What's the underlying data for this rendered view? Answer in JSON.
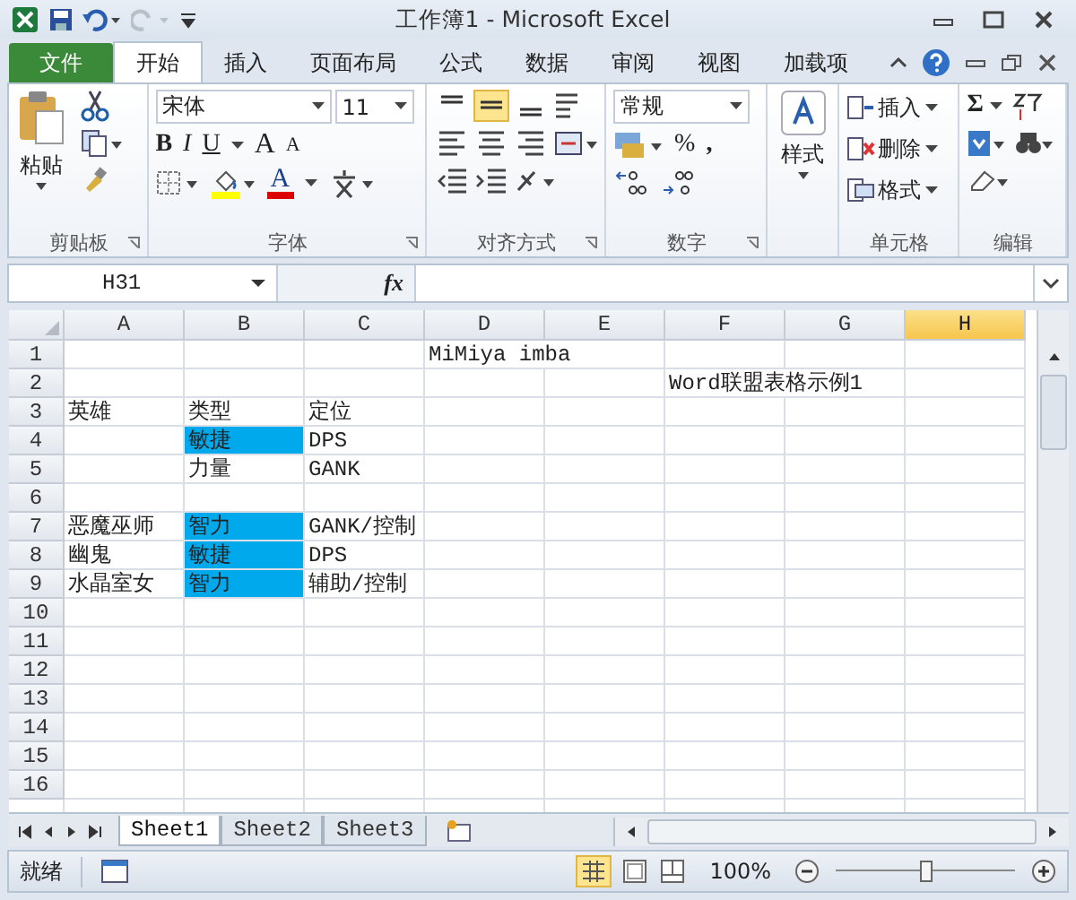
{
  "window": {
    "title": "工作簿1 - Microsoft Excel"
  },
  "ribbon_tabs": [
    {
      "label": "文件",
      "kind": "file",
      "selected": false
    },
    {
      "label": "开始",
      "kind": "tab",
      "selected": true
    },
    {
      "label": "插入",
      "kind": "tab",
      "selected": false
    },
    {
      "label": "页面布局",
      "kind": "tab",
      "selected": false
    },
    {
      "label": "公式",
      "kind": "tab",
      "selected": false
    },
    {
      "label": "数据",
      "kind": "tab",
      "selected": false
    },
    {
      "label": "审阅",
      "kind": "tab",
      "selected": false
    },
    {
      "label": "视图",
      "kind": "tab",
      "selected": false
    },
    {
      "label": "加载项",
      "kind": "tab",
      "selected": false
    }
  ],
  "clipboard": {
    "label": "剪贴板",
    "paste": "粘贴"
  },
  "font": {
    "label": "字体",
    "name": "宋体",
    "size": "11",
    "bold": "B",
    "italic": "I",
    "underline": "U",
    "grow": "A",
    "shrink": "A",
    "text_color": "A"
  },
  "alignment": {
    "label": "对齐方式",
    "vertical": [
      {
        "selected": false
      },
      {
        "selected": true
      },
      {
        "selected": false
      }
    ]
  },
  "number": {
    "label": "数字",
    "format": "常规",
    "percent": "%",
    "comma": ","
  },
  "styles": {
    "label": "样式"
  },
  "cells": {
    "label": "单元格",
    "items": [
      "插入",
      "删除",
      "格式"
    ]
  },
  "editing": {
    "label": "编辑",
    "sum": "Σ"
  },
  "formula_bar": {
    "name_box": "H31",
    "fx": "fx"
  },
  "sheet": {
    "columns": [
      {
        "label": "A",
        "selected": false
      },
      {
        "label": "B",
        "selected": false
      },
      {
        "label": "C",
        "selected": false
      },
      {
        "label": "D",
        "selected": false
      },
      {
        "label": "E",
        "selected": false
      },
      {
        "label": "F",
        "selected": false
      },
      {
        "label": "G",
        "selected": false
      },
      {
        "label": "H",
        "selected": true
      }
    ],
    "rows": [
      {
        "label": "1",
        "d": {
          "text": "MiMiya imba",
          "highlighted": false
        }
      },
      {
        "label": "2",
        "f": {
          "text": "Word联盟表格示例1",
          "highlighted": false
        }
      },
      {
        "label": "3",
        "a": {
          "text": "英雄",
          "highlighted": false
        },
        "b": {
          "text": "类型",
          "highlighted": false
        },
        "c": {
          "text": "定位",
          "highlighted": false
        }
      },
      {
        "label": "4",
        "b": {
          "text": "敏捷",
          "highlighted": true
        },
        "c": {
          "text": "DPS",
          "highlighted": false
        }
      },
      {
        "label": "5",
        "b": {
          "text": "力量",
          "highlighted": false
        },
        "c": {
          "text": "GANK",
          "highlighted": false
        }
      },
      {
        "label": "6"
      },
      {
        "label": "7",
        "a": {
          "text": "恶魔巫师",
          "highlighted": false
        },
        "b": {
          "text": "智力",
          "highlighted": true
        },
        "c": {
          "text": "GANK/控制",
          "highlighted": false
        }
      },
      {
        "label": "8",
        "a": {
          "text": "幽鬼",
          "highlighted": false
        },
        "b": {
          "text": "敏捷",
          "highlighted": true
        },
        "c": {
          "text": "DPS",
          "highlighted": false
        }
      },
      {
        "label": "9",
        "a": {
          "text": "水晶室女",
          "highlighted": false
        },
        "b": {
          "text": "智力",
          "highlighted": true
        },
        "c": {
          "text": "辅助/控制",
          "highlighted": false
        }
      },
      {
        "label": "10"
      },
      {
        "label": "11"
      },
      {
        "label": "12"
      },
      {
        "label": "13"
      },
      {
        "label": "14"
      },
      {
        "label": "15"
      },
      {
        "label": "16"
      }
    ]
  },
  "sheet_tabs": [
    {
      "label": "Sheet1",
      "selected": true
    },
    {
      "label": "Sheet2",
      "selected": false
    },
    {
      "label": "Sheet3",
      "selected": false
    }
  ],
  "status_bar": {
    "status": "就绪",
    "zoom": "100%",
    "level": 0.5
  }
}
